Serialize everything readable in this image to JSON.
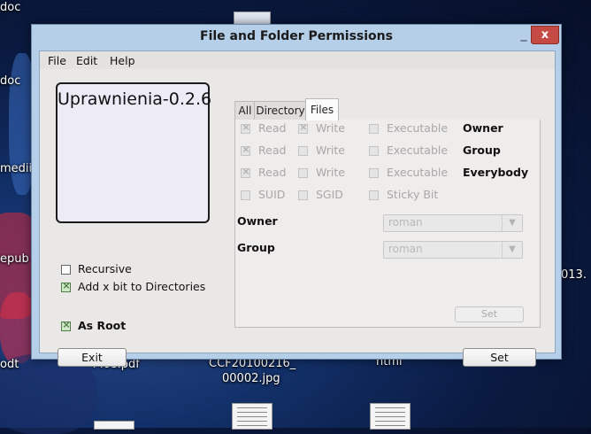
{
  "desktop": {
    "labels": [
      "doc",
      "doc",
      "medii",
      "epub",
      "odt",
      "449s.pdf",
      "CCF20100216_",
      "00002.jpg",
      "html",
      "013."
    ]
  },
  "window": {
    "title": "File and Folder Permissions",
    "minimize": "_",
    "close": "x"
  },
  "menu": {
    "file": "File",
    "edit": "Edit",
    "help": "Help"
  },
  "app_name": "Uprawnienia-0.2.6",
  "left": {
    "recursive": "Recursive",
    "add_x_bit": "Add x bit to Directories",
    "as_root": "As Root",
    "exit": "Exit"
  },
  "tabs": {
    "all": "All",
    "directory": "Directory",
    "files": "Files"
  },
  "perms": {
    "read": "Read",
    "write": "Write",
    "executable": "Executable",
    "owner": "Owner",
    "group": "Group",
    "everybody": "Everybody",
    "suid": "SUID",
    "sgid": "SGID",
    "sticky": "Sticky Bit"
  },
  "owner_label": "Owner",
  "group_label": "Group",
  "owner_value": "roman",
  "group_value": "roman",
  "panel_set": "Set",
  "main_set": "Set"
}
